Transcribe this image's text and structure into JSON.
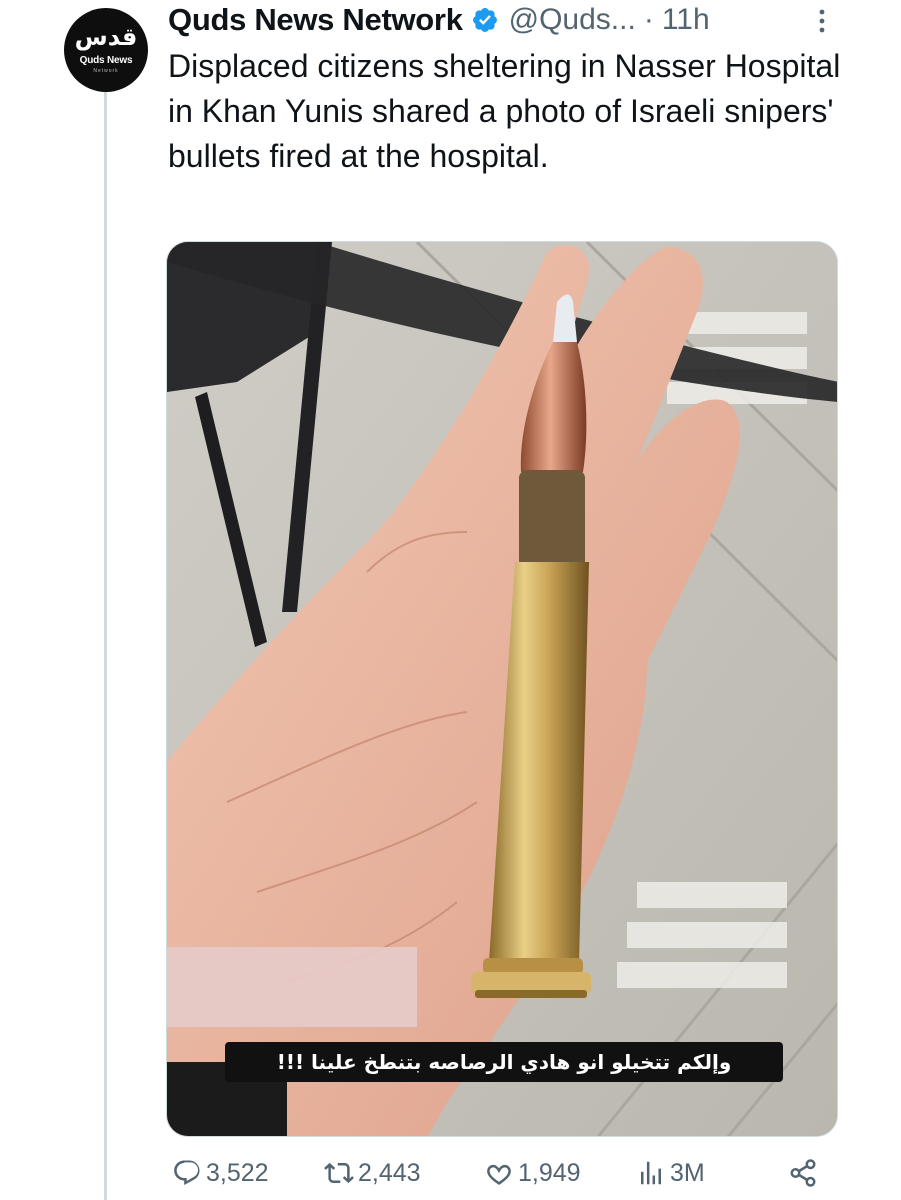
{
  "author": {
    "display_name": "Quds News Network",
    "handle": "@Quds...",
    "separator": "·",
    "time": "11h",
    "verified": true,
    "avatar": {
      "logo_text": "قدس",
      "name_text": "Quds News",
      "sub_text": "Network"
    }
  },
  "tweet": {
    "text": "Displaced citizens sheltering in Nasser Hospital in Khan Yunis shared a photo of Israeli snipers' bullets fired at the hospital."
  },
  "media": {
    "caption": "وإلكم تتخيلو انو هادي الرصاصه بتنطخ علينا !!!"
  },
  "actions": {
    "replies": "3,522",
    "retweets": "2,443",
    "likes": "1,949",
    "views": "3M"
  },
  "colors": {
    "text": "#0f1419",
    "secondary": "#536471",
    "verified": "#1d9bf0",
    "thread_line": "#cfd9de"
  },
  "icons": [
    "verified-badge-icon",
    "more-icon",
    "reply-icon",
    "retweet-icon",
    "like-icon",
    "views-icon",
    "share-icon"
  ]
}
